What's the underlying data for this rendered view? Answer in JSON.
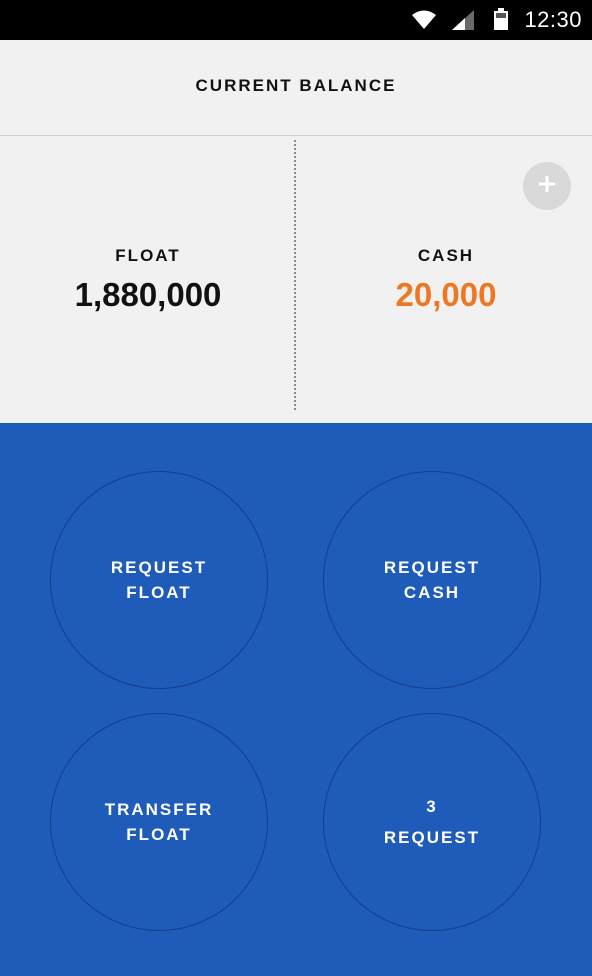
{
  "status_bar": {
    "time": "12:30",
    "icons": [
      "wifi-icon",
      "signal-icon",
      "battery-icon"
    ]
  },
  "header": {
    "title": "CURRENT BALANCE"
  },
  "balances": {
    "float": {
      "label": "FLOAT",
      "value": "1,880,000"
    },
    "cash": {
      "label": "CASH",
      "value": "20,000"
    },
    "add_icon": "plus-icon"
  },
  "actions": {
    "request_float": {
      "line1": "REQUEST",
      "line2": "FLOAT"
    },
    "request_cash": {
      "line1": "REQUEST",
      "line2": "CASH"
    },
    "transfer_float": {
      "line1": "TRANSFER",
      "line2": "FLOAT"
    },
    "requests": {
      "count": "3",
      "label": "REQUEST"
    }
  },
  "colors": {
    "actions_background": "#1f5cba",
    "cash_value": "#ef7622",
    "page_background": "#f1f1f1"
  }
}
